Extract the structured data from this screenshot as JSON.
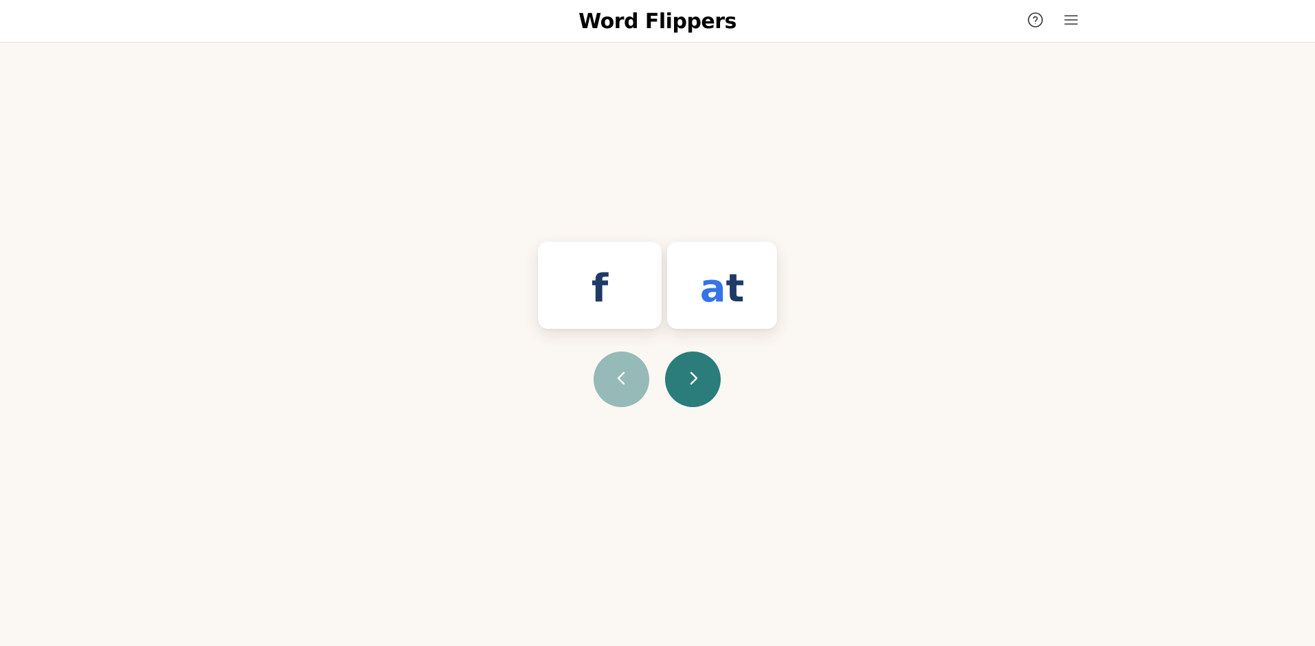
{
  "header": {
    "title": "Word Flippers",
    "help_icon": "help-circle-icon",
    "menu_icon": "hamburger-menu-icon"
  },
  "cards": {
    "onset": "f",
    "rime_vowel": "a",
    "rime_end": "t"
  },
  "navigation": {
    "prev_icon": "chevron-left-icon",
    "next_icon": "chevron-right-icon",
    "prev_enabled": false,
    "next_enabled": true
  },
  "colors": {
    "background": "#fbf7f3",
    "letter_dark": "#1f3a66",
    "letter_blue": "#3474e6",
    "next_button": "#2a7d7b",
    "prev_button_disabled": "#95bab7"
  }
}
